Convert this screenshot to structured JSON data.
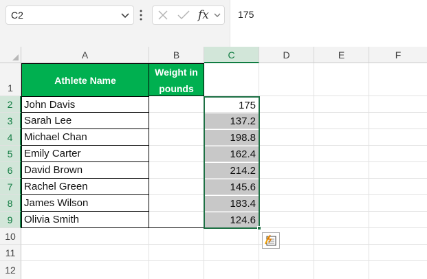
{
  "formula_bar": {
    "name_box": "C2",
    "fx_label": "fx",
    "formula": "175"
  },
  "columns": [
    "A",
    "B",
    "C",
    "D",
    "E",
    "F"
  ],
  "rows": [
    "1",
    "2",
    "3",
    "4",
    "5",
    "6",
    "7",
    "8",
    "9",
    "10",
    "11",
    "12"
  ],
  "table": {
    "header_name": "Athlete Name",
    "header_weight": "Weight in pounds",
    "names": [
      "John Davis",
      "Sarah Lee",
      "Michael Chan",
      "Emily Carter",
      "David Brown",
      "Rachel Green",
      "James Wilson",
      "Olivia Smith"
    ],
    "weights": [
      "175",
      "137.2",
      "198.8",
      "162.4",
      "214.2",
      "145.6",
      "183.4",
      "124.6"
    ]
  },
  "colors": {
    "header_fill": "#00b050",
    "selection": "#1d7044",
    "highlight_fill": "#c8c8c8"
  },
  "icons": [
    "chevron-down-icon",
    "more-vertical-icon",
    "cancel-icon",
    "enter-check-icon",
    "fx-icon",
    "quick-analysis-icon"
  ]
}
